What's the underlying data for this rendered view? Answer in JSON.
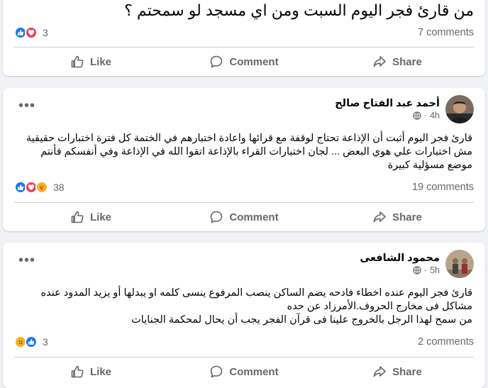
{
  "posts": [
    {
      "text": "من قارئ فجر اليوم السبت ومن اي مسجد لو سمحتم ؟",
      "reaction_count": "3",
      "comments": "7 comments",
      "actions": {
        "like": "Like",
        "comment": "Comment",
        "share": "Share"
      }
    },
    {
      "author": "أحمد عبد الفتاح صالح",
      "time": "4h",
      "lines": [
        "قارئ فجر اليوم أثبت أن الإذاعة تحتاج لوقفة مع قرائها واعادة اختبارهم في الختمة كل فترة اختبارات حقيقية",
        "مش اختبارات علي هوي البعض ... لجان اختبارات القراء بالإذاعة اتقوا الله في الإذاعة وفي أنفسكم فأنتم",
        "موضع مسؤلية كبيرة"
      ],
      "reaction_count": "38",
      "comments": "19 comments",
      "actions": {
        "like": "Like",
        "comment": "Comment",
        "share": "Share"
      }
    },
    {
      "author": "محمود الشافعى",
      "time": "5h",
      "lines": [
        "قارئ فجر اليوم عنده اخطاء فادحه يضم الساكن ينصب المرفوع ينسى كلمه او يبدلها أو يزيد المدود عنده",
        "مشاكل فى مخارج الحروف.الأمرزاد عن حده",
        "من سمح لهذا الرجل بالخروج علينا فى قرآن الفجر يجب أن يحال لمحكمة الجنايات"
      ],
      "reaction_count": "3",
      "comments": "2 comments",
      "actions": {
        "like": "Like",
        "comment": "Comment",
        "share": "Share"
      }
    }
  ],
  "colors": {
    "accent": "#1877f2",
    "love": "#f33e58",
    "muted": "#65676b",
    "background": "#f0f2f5"
  }
}
